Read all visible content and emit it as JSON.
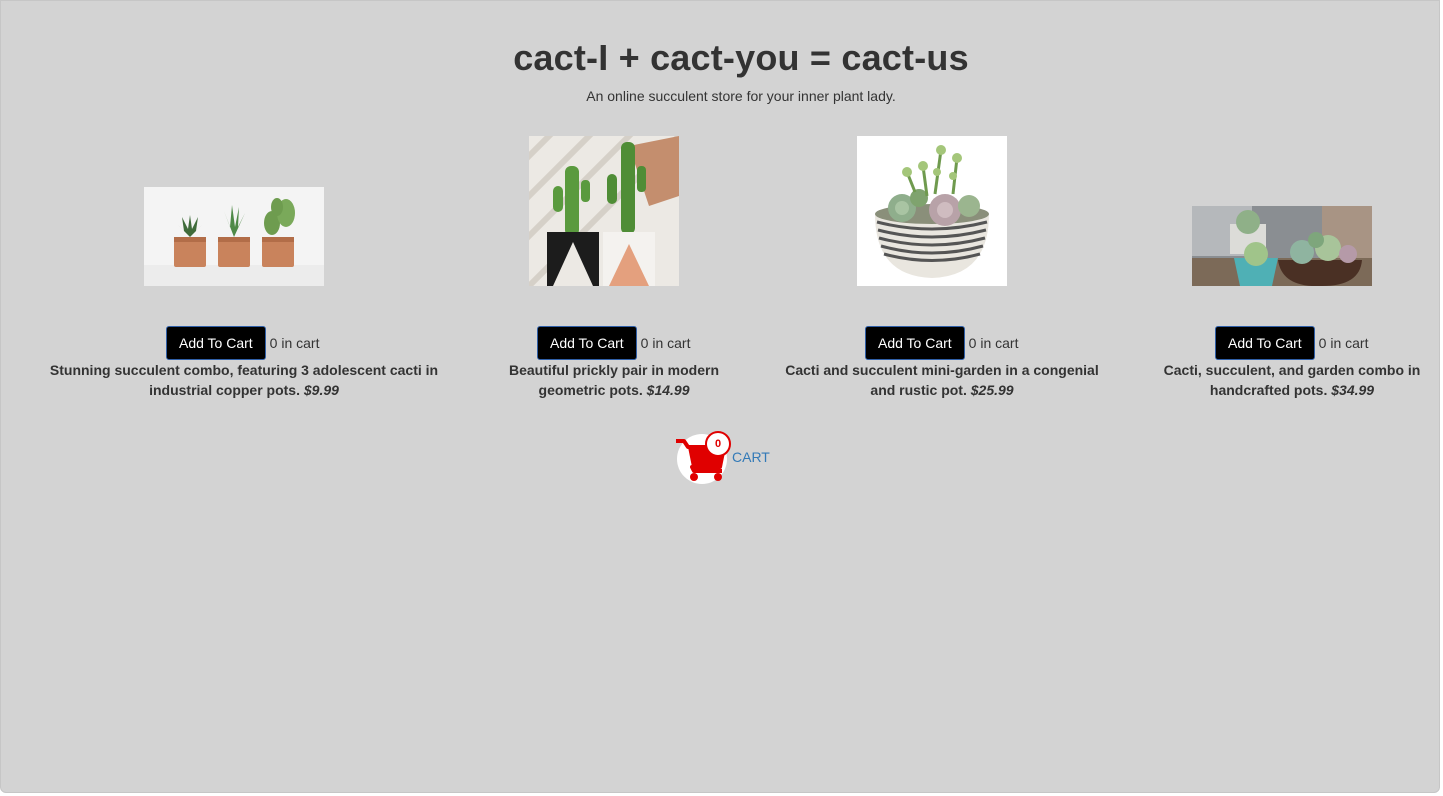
{
  "header": {
    "title": "cact-I + cact-you = cact-us",
    "subtitle": "An online succulent store for your inner plant lady."
  },
  "products": [
    {
      "add_label": "Add To Cart",
      "count_text": "0 in cart",
      "description": "Stunning succulent combo, featuring 3 adolescent cacti in industrial copper pots.",
      "price": "$9.99"
    },
    {
      "add_label": "Add To Cart",
      "count_text": "0 in cart",
      "description": "Beautiful prickly pair in modern geometric pots.",
      "price": "$14.99"
    },
    {
      "add_label": "Add To Cart",
      "count_text": "0 in cart",
      "description": "Cacti and succulent mini-garden in a congenial and rustic pot.",
      "price": "$25.99"
    },
    {
      "add_label": "Add To Cart",
      "count_text": "0 in cart",
      "description": "Cacti, succulent, and garden combo in handcrafted pots.",
      "price": "$34.99"
    }
  ],
  "cart": {
    "label": "CART",
    "count": "0",
    "icon": "shopping-cart-icon"
  },
  "colors": {
    "background": "#d3d3d3",
    "button": "#000000",
    "cart_red": "#e00000",
    "link": "#337ab7"
  }
}
